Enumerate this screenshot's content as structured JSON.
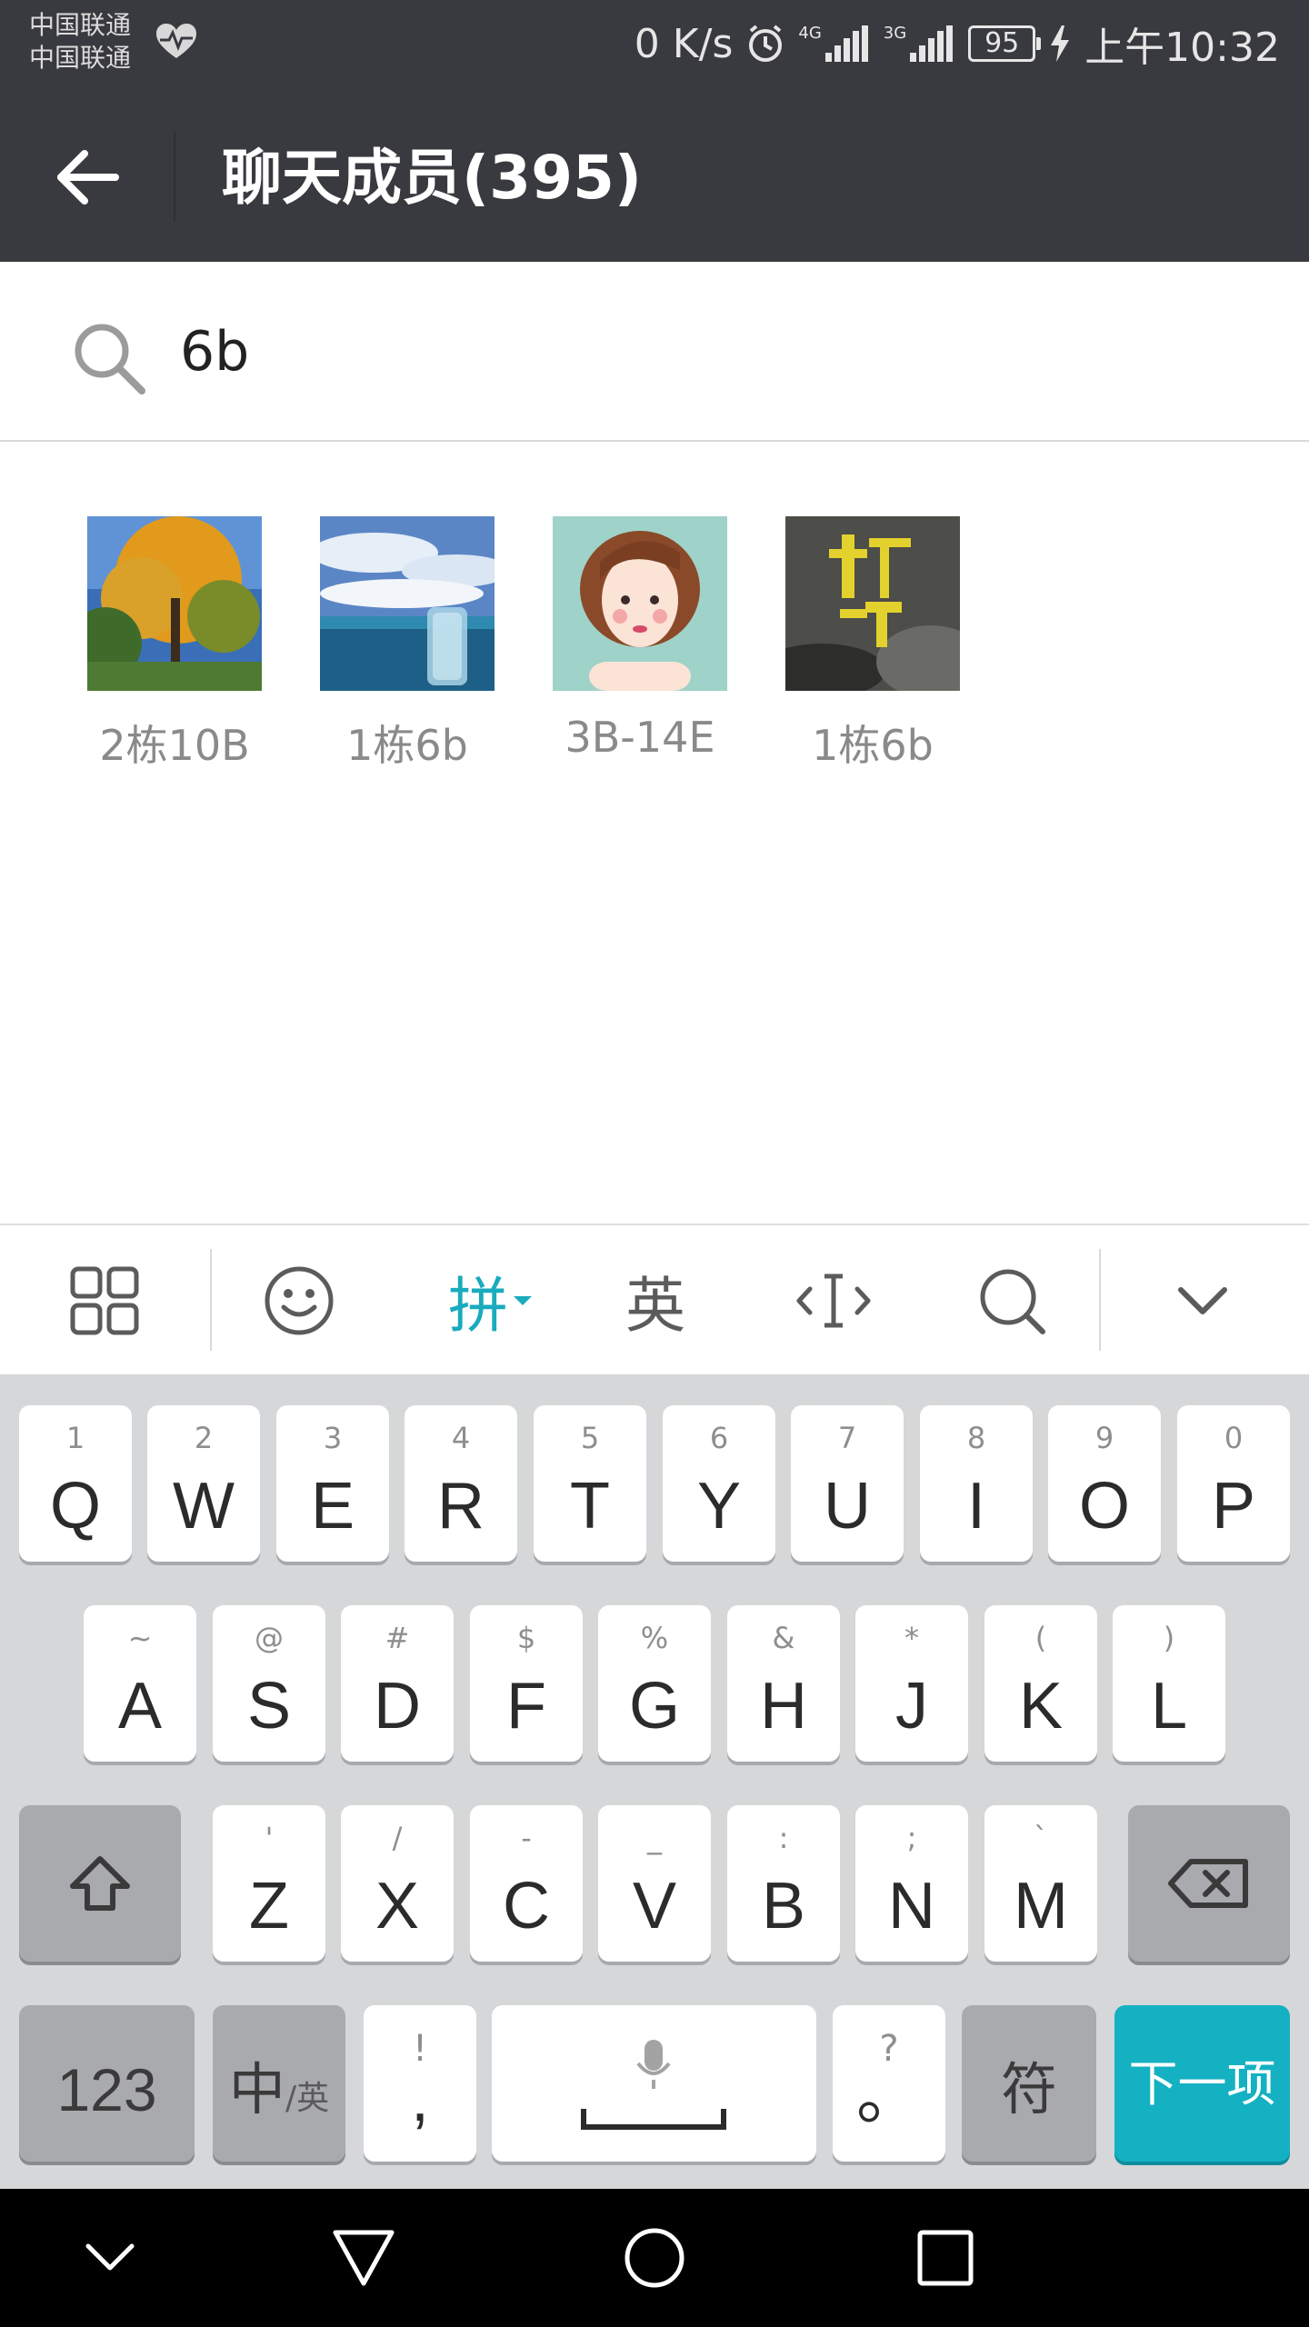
{
  "status_bar": {
    "carrier1": "中国联通",
    "carrier2": "中国联通",
    "net_speed": "0 K/s",
    "network1": "4G",
    "network2": "3G",
    "battery": "95",
    "time": "上午10:32"
  },
  "header": {
    "title": "聊天成员(395)"
  },
  "search": {
    "value": "6b"
  },
  "results": [
    {
      "name": "2栋10B"
    },
    {
      "name": "1栋6b"
    },
    {
      "name": "3B-14E"
    },
    {
      "name": "1栋6b"
    }
  ],
  "keyboard_toolbar": {
    "pinyin": "拼",
    "english": "英"
  },
  "keyboard": {
    "row1": [
      {
        "sub": "1",
        "main": "Q"
      },
      {
        "sub": "2",
        "main": "W"
      },
      {
        "sub": "3",
        "main": "E"
      },
      {
        "sub": "4",
        "main": "R"
      },
      {
        "sub": "5",
        "main": "T"
      },
      {
        "sub": "6",
        "main": "Y"
      },
      {
        "sub": "7",
        "main": "U"
      },
      {
        "sub": "8",
        "main": "I"
      },
      {
        "sub": "9",
        "main": "O"
      },
      {
        "sub": "0",
        "main": "P"
      }
    ],
    "row2": [
      {
        "sub": "~",
        "main": "A"
      },
      {
        "sub": "@",
        "main": "S"
      },
      {
        "sub": "#",
        "main": "D"
      },
      {
        "sub": "$",
        "main": "F"
      },
      {
        "sub": "%",
        "main": "G"
      },
      {
        "sub": "&",
        "main": "H"
      },
      {
        "sub": "*",
        "main": "J"
      },
      {
        "sub": "(",
        "main": "K"
      },
      {
        "sub": ")",
        "main": "L"
      }
    ],
    "row3": [
      {
        "sub": "'",
        "main": "Z"
      },
      {
        "sub": "/",
        "main": "X"
      },
      {
        "sub": "-",
        "main": "C"
      },
      {
        "sub": "_",
        "main": "V"
      },
      {
        "sub": ":",
        "main": "B"
      },
      {
        "sub": ";",
        "main": "N"
      },
      {
        "sub": "`",
        "main": "M"
      }
    ],
    "numbers_label": "123",
    "lang_main": "中",
    "lang_sub": "/英",
    "comma_sub": "!",
    "comma_main": ",",
    "period_sub": "?",
    "period_main": "。",
    "symbols_label": "符",
    "enter_label": "下一项"
  },
  "colors": {
    "header_bg": "#393a3f",
    "accent": "#14b1c3",
    "keyboard_bg": "#d6d7d9"
  }
}
